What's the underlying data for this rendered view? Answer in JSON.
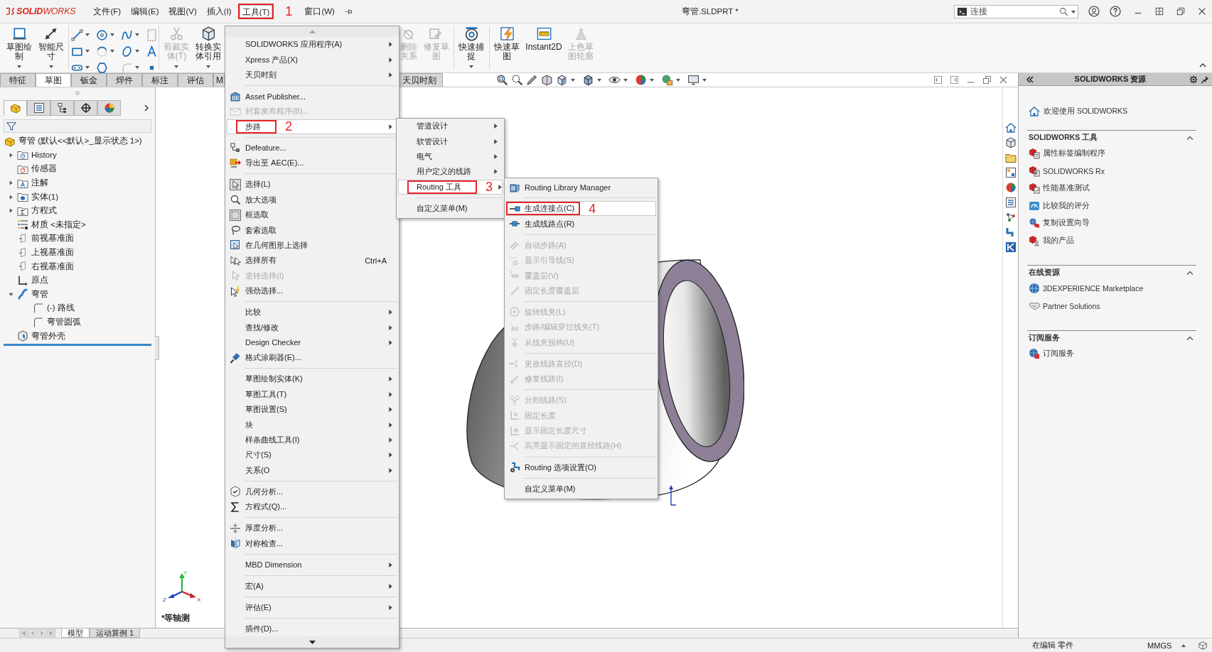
{
  "title_bar": {
    "logo": "**SOLID**WORKS",
    "menus": [
      {
        "label": "文件(F)",
        "selected": false
      },
      {
        "label": "编辑(E)",
        "selected": false
      },
      {
        "label": "视图(V)",
        "selected": false
      },
      {
        "label": "插入(I)",
        "selected": false
      },
      {
        "label": "工具(T)",
        "selected": true,
        "callout": "1"
      },
      {
        "label": "窗口(W)",
        "selected": false
      }
    ],
    "document_title": "弯管.SLDPRT *",
    "search": {
      "placeholder": "连接"
    }
  },
  "command_manager": {
    "groups": [
      {
        "kind": "buttons",
        "items": [
          {
            "label": "草图绘制",
            "kind": "sketch",
            "dropdown": true,
            "disabled": false
          },
          {
            "label": "智能尺寸",
            "kind": "smart-dimension",
            "dropdown": true,
            "disabled": false
          }
        ]
      },
      {
        "kind": "grid",
        "items": [
          {
            "kind": "line",
            "dropdown": true,
            "disabled": false
          },
          {
            "kind": "circle",
            "dropdown": true,
            "disabled": false
          },
          {
            "kind": "spline",
            "dropdown": true,
            "disabled": false
          },
          {
            "kind": "construction",
            "dropdown": false,
            "disabled": false
          },
          {
            "kind": "rectangle",
            "dropdown": true,
            "disabled": false
          },
          {
            "kind": "arc",
            "dropdown": true,
            "disabled": false
          },
          {
            "kind": "ellipse",
            "dropdown": true,
            "disabled": false
          },
          {
            "kind": "text",
            "dropdown": false,
            "disabled": false
          },
          {
            "kind": "slot",
            "dropdown": true,
            "disabled": false
          },
          {
            "kind": "polygon",
            "dropdown": false,
            "disabled": false
          },
          {
            "kind": "fillet",
            "dropdown": true,
            "disabled": true
          },
          {
            "kind": "point",
            "dropdown": false,
            "disabled": false
          }
        ]
      },
      {
        "kind": "buttons",
        "items": [
          {
            "label": "剪裁实体(T)",
            "kind": "trim",
            "dropdown": true,
            "disabled": true
          },
          {
            "label": "转换实体引用",
            "kind": "convert",
            "dropdown": true,
            "disabled": false
          },
          {
            "label": "删除关系",
            "kind": "relations",
            "dropdown": false,
            "disabled": true
          },
          {
            "label": "修复草图",
            "kind": "repair-sketch",
            "dropdown": false,
            "disabled": true
          }
        ]
      },
      {
        "kind": "buttons",
        "items": [
          {
            "label": "快速捕捉",
            "kind": "quick-snap",
            "dropdown": true,
            "disabled": false
          }
        ]
      },
      {
        "kind": "buttons",
        "items": [
          {
            "label": "快速草图",
            "kind": "rapid-sketch",
            "dropdown": false,
            "disabled": false
          },
          {
            "label": "Instant2D",
            "kind": "instant2d",
            "dropdown": false,
            "disabled": false
          },
          {
            "label": "上色草图轮廓",
            "kind": "shaded-sketch",
            "dropdown": false,
            "disabled": true
          }
        ]
      }
    ]
  },
  "command_tabs": [
    {
      "label": "特征",
      "selected": false
    },
    {
      "label": "草图",
      "selected": true
    },
    {
      "label": "钣金",
      "selected": false
    },
    {
      "label": "焊件",
      "selected": false
    },
    {
      "label": "标注",
      "selected": false
    },
    {
      "label": "评估",
      "selected": false
    },
    {
      "label": "M",
      "selected": false
    },
    {
      "label": "天贝时刻",
      "selected": false
    }
  ],
  "tools_menu": {
    "sections": [
      [
        {
          "label": "SOLIDWORKS 应用程序(A)",
          "submenu": true,
          "disabled": false,
          "selected": false,
          "checked": false
        },
        {
          "label": "Xpress 产品(X)",
          "submenu": true,
          "disabled": false,
          "selected": false,
          "checked": false
        },
        {
          "label": "天贝时刻",
          "submenu": true,
          "disabled": false,
          "selected": false,
          "checked": false
        }
      ],
      [
        {
          "label": "Asset Publisher...",
          "kind": "asset-publisher",
          "submenu": false,
          "disabled": false,
          "selected": false,
          "checked": false
        },
        {
          "label": "封套发布程序(B)...",
          "kind": "pack-publish",
          "submenu": false,
          "disabled": true,
          "selected": false,
          "checked": false
        },
        {
          "label": "步路",
          "submenu": true,
          "disabled": false,
          "selected": true,
          "checked": false,
          "callout": "2"
        }
      ],
      [
        {
          "label": "Defeature...",
          "kind": "defeature",
          "submenu": false,
          "disabled": false,
          "selected": false,
          "checked": false
        },
        {
          "label": "导出至 AEC(E)...",
          "kind": "export-aec",
          "submenu": false,
          "disabled": false,
          "selected": false,
          "checked": false
        }
      ],
      [
        {
          "label": "选择(L)",
          "kind": "select-arrow",
          "submenu": false,
          "disabled": false,
          "selected": false,
          "checked": true
        },
        {
          "label": "放大选项",
          "kind": "magnify-select",
          "submenu": false,
          "disabled": false,
          "selected": false,
          "checked": false
        },
        {
          "label": "框选取",
          "kind": "box-select",
          "submenu": false,
          "disabled": false,
          "selected": false,
          "checked": true
        },
        {
          "label": "套索选取",
          "kind": "lasso",
          "submenu": false,
          "disabled": false,
          "selected": false,
          "checked": false
        },
        {
          "label": "在几何图形上选择",
          "kind": "select-geometry",
          "submenu": false,
          "disabled": false,
          "selected": false,
          "checked": false
        },
        {
          "label": "选择所有",
          "kind": "select-all",
          "shortcut": "Ctrl+A",
          "submenu": false,
          "disabled": false,
          "selected": false,
          "checked": false
        },
        {
          "label": "逆转选择(I)",
          "kind": "invert-select",
          "submenu": false,
          "disabled": true,
          "selected": false,
          "checked": false
        },
        {
          "label": "强劲选择...",
          "kind": "power-select",
          "submenu": false,
          "disabled": false,
          "selected": false,
          "checked": false
        }
      ],
      [
        {
          "label": "比较",
          "submenu": true,
          "disabled": false,
          "selected": false,
          "checked": false
        },
        {
          "label": "查找/修改",
          "submenu": true,
          "disabled": false,
          "selected": false,
          "checked": false
        },
        {
          "label": "Design Checker",
          "submenu": true,
          "disabled": false,
          "selected": false,
          "checked": false
        },
        {
          "label": "格式涂刷器(E)...",
          "kind": "format-painter",
          "submenu": false,
          "disabled": false,
          "selected": false,
          "checked": false
        }
      ],
      [
        {
          "label": "草图绘制实体(K)",
          "submenu": true,
          "disabled": false,
          "selected": false,
          "checked": false
        },
        {
          "label": "草图工具(T)",
          "submenu": true,
          "disabled": false,
          "selected": false,
          "checked": false
        },
        {
          "label": "草图设置(S)",
          "submenu": true,
          "disabled": false,
          "selected": false,
          "checked": false
        },
        {
          "label": "块",
          "submenu": true,
          "disabled": false,
          "selected": false,
          "checked": false
        },
        {
          "label": "样条曲线工具(I)",
          "submenu": true,
          "disabled": false,
          "selected": false,
          "checked": false
        },
        {
          "label": "尺寸(S)",
          "submenu": true,
          "disabled": false,
          "selected": false,
          "checked": false
        },
        {
          "label": "关系(O",
          "submenu": true,
          "disabled": false,
          "selected": false,
          "checked": false
        }
      ],
      [
        {
          "label": "几何分析...",
          "kind": "geometry-analysis",
          "submenu": false,
          "disabled": false,
          "selected": false,
          "checked": false
        },
        {
          "label": "方程式(Q)...",
          "kind": "equation",
          "submenu": false,
          "disabled": false,
          "selected": false,
          "checked": false
        }
      ],
      [
        {
          "label": "厚度分析...",
          "kind": "thickness",
          "submenu": false,
          "disabled": false,
          "selected": false,
          "checked": false
        },
        {
          "label": "对称检查...",
          "kind": "symmetry",
          "submenu": false,
          "disabled": false,
          "selected": false,
          "checked": false
        }
      ],
      [
        {
          "label": "MBD Dimension",
          "submenu": true,
          "disabled": false,
          "selected": false,
          "checked": false
        }
      ],
      [
        {
          "label": "宏(A)",
          "submenu": true,
          "disabled": false,
          "selected": false,
          "checked": false
        }
      ],
      [
        {
          "label": "评估(E)",
          "submenu": true,
          "disabled": false,
          "selected": false,
          "checked": false
        }
      ],
      [
        {
          "label": "插件(D)...",
          "submenu": false,
          "disabled": false,
          "selected": false,
          "checked": false
        }
      ]
    ]
  },
  "route_menu": {
    "sections": [
      [
        {
          "label": "管道设计",
          "submenu": true,
          "disabled": false,
          "selected": false
        },
        {
          "label": "软管设计",
          "submenu": true,
          "disabled": false,
          "selected": false
        },
        {
          "label": "电气",
          "submenu": true,
          "disabled": false,
          "selected": false
        },
        {
          "label": "用户定义的线路",
          "submenu": true,
          "disabled": false,
          "selected": false
        },
        {
          "label": "Routing 工具",
          "submenu": true,
          "disabled": false,
          "selected": true,
          "callout": "3"
        }
      ],
      [
        {
          "label": "自定义菜单(M)",
          "submenu": false,
          "disabled": false,
          "selected": false
        }
      ]
    ]
  },
  "routing_tools_menu": {
    "sections": [
      [
        {
          "label": "Routing Library Manager",
          "kind": "library-manager",
          "submenu": false,
          "disabled": false,
          "selected": false
        }
      ],
      [
        {
          "label": "生成连接点(C)",
          "kind": "connection-point",
          "submenu": false,
          "disabled": false,
          "selected": true,
          "callout": "4"
        },
        {
          "label": "生成线路点(R)",
          "kind": "route-point",
          "submenu": false,
          "disabled": false,
          "selected": false
        }
      ],
      [
        {
          "label": "自动步路(A)",
          "kind": "auto-route",
          "submenu": false,
          "disabled": true,
          "selected": false
        },
        {
          "label": "显示引导线(S)",
          "kind": "show-guidelines",
          "submenu": false,
          "disabled": true,
          "selected": false
        },
        {
          "label": "覆盖层(V)",
          "kind": "covering",
          "submenu": false,
          "disabled": true,
          "selected": false
        },
        {
          "label": "固定长度覆盖层",
          "kind": "fixed-covering",
          "submenu": false,
          "disabled": true,
          "selected": false
        }
      ],
      [
        {
          "label": "旋转线夹(L)",
          "kind": "rotate-clip",
          "submenu": false,
          "disabled": true,
          "selected": false
        },
        {
          "label": "步路/编辑穿过线夹(T)",
          "kind": "route-clip",
          "submenu": false,
          "disabled": true,
          "selected": false
        },
        {
          "label": "从线夹脱钩(U)",
          "kind": "unhook-clip",
          "submenu": false,
          "disabled": true,
          "selected": false
        }
      ],
      [
        {
          "label": "更改线路直径(D)",
          "kind": "change-diameter",
          "submenu": false,
          "disabled": true,
          "selected": false
        },
        {
          "label": "修复线路(I)",
          "kind": "repair-route",
          "submenu": false,
          "disabled": true,
          "selected": false
        }
      ],
      [
        {
          "label": "分割线路(S)",
          "kind": "split-route",
          "submenu": false,
          "disabled": true,
          "selected": false
        },
        {
          "label": "固定长度",
          "kind": "fixed-length",
          "submenu": false,
          "disabled": true,
          "selected": false
        },
        {
          "label": "显示固定长度尺寸",
          "kind": "show-fixed-length",
          "submenu": false,
          "disabled": true,
          "selected": false
        },
        {
          "label": "高亮显示固定的直径线路(H)",
          "kind": "highlight-diameter",
          "submenu": false,
          "disabled": true,
          "selected": false
        }
      ],
      [
        {
          "label": "Routing 选项设置(O)",
          "kind": "routing-options",
          "submenu": false,
          "disabled": false,
          "selected": false
        }
      ],
      [
        {
          "label": "自定义菜单(M)",
          "submenu": false,
          "disabled": false,
          "selected": false
        }
      ]
    ]
  },
  "feature_manager": {
    "tabs": [
      {
        "kind": "feature-tree",
        "selected": true
      },
      {
        "kind": "property-manager",
        "selected": false
      },
      {
        "kind": "configuration-manager",
        "selected": false
      },
      {
        "kind": "dimxpert",
        "selected": false
      },
      {
        "kind": "display-manager",
        "selected": false
      }
    ],
    "tree": {
      "label": "弯管  (默认<<默认>_显示状态 1>)",
      "kind": "part",
      "children": [
        {
          "label": "History",
          "kind": "history",
          "expanded": false
        },
        {
          "label": "传感器",
          "kind": "sensor"
        },
        {
          "label": "注解",
          "kind": "annotation",
          "expanded": false
        },
        {
          "label": "实体(1)",
          "kind": "body",
          "expanded": false
        },
        {
          "label": "方程式",
          "kind": "equations",
          "expanded": false
        },
        {
          "label": "材质 <未指定>",
          "kind": "material"
        },
        {
          "label": "前视基准面",
          "kind": "plane"
        },
        {
          "label": "上视基准面",
          "kind": "plane"
        },
        {
          "label": "右视基准面",
          "kind": "plane"
        },
        {
          "label": "原点",
          "kind": "origin"
        },
        {
          "label": "弯管",
          "kind": "route",
          "expanded": true,
          "children": [
            {
              "label": "(-) 路线",
              "kind": "sketch-feature"
            },
            {
              "label": "弯管圆弧",
              "kind": "sketch-feature"
            }
          ]
        },
        {
          "label": "弯管外壳",
          "kind": "shell"
        }
      ]
    }
  },
  "viewport": {
    "view_label": "*等轴测",
    "axis_labels": [
      "Y",
      "Z",
      "X"
    ]
  },
  "bottom_tabs": [
    {
      "label": "模型",
      "selected": true
    },
    {
      "label": "运动算例 1",
      "selected": false
    }
  ],
  "task_pane": {
    "title": "SOLIDWORKS 资源",
    "welcome": "欢迎使用  SOLIDWORKS",
    "sections": [
      {
        "title": "SOLIDWORKS 工具",
        "expanded": true,
        "items": [
          {
            "label": "属性标签编制程序",
            "kind": "property-tab-builder"
          },
          {
            "label": "SOLIDWORKS Rx",
            "kind": "sw-rx"
          },
          {
            "label": "性能基准测试",
            "kind": "benchmark"
          },
          {
            "label": "比较我的评分",
            "kind": "compare-score"
          },
          {
            "label": "复制设置向导",
            "kind": "copy-settings"
          },
          {
            "label": "我的产品",
            "kind": "my-products"
          }
        ]
      },
      {
        "title": "在线资源",
        "expanded": true,
        "items": [
          {
            "label": "3DEXPERIENCE Marketplace",
            "kind": "marketplace"
          },
          {
            "label": "Partner Solutions",
            "kind": "partner"
          }
        ]
      },
      {
        "title": "订阅服务",
        "expanded": true,
        "items": [
          {
            "label": "订阅服务",
            "kind": "subscription"
          }
        ]
      }
    ]
  },
  "status_bar": {
    "edit_state": "在编辑 零件",
    "units": "MMGS"
  }
}
